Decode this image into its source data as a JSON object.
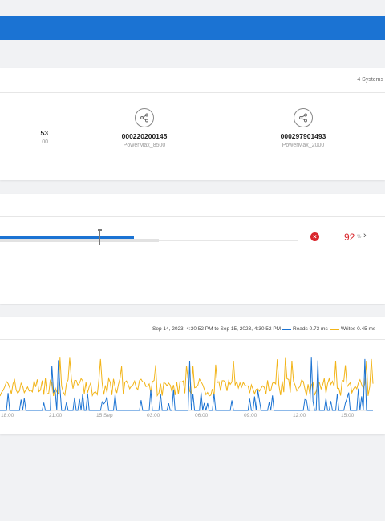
{
  "systems": {
    "count_label": "4 Systems",
    "items": [
      {
        "id": "53",
        "model": "00"
      },
      {
        "id": "000220200145",
        "model": "PowerMax_8500"
      },
      {
        "id": "000297901493",
        "model": "PowerMax_2000"
      }
    ]
  },
  "capacity": {
    "percent": "92",
    "unit": "%",
    "bar_fill_fraction": 0.84,
    "status_color": "#d9262c"
  },
  "latency": {
    "range": "Sep 14, 2023, 4:30:52 PM to Sep 15, 2023, 4:30:52 PM",
    "legend": {
      "reads": "Reads 0.73 ms",
      "writes": "Writes 0.45 ms"
    },
    "x_ticks": [
      "18:00",
      "21:00",
      "15 Sep",
      "03:00",
      "06:00",
      "09:00",
      "12:00",
      "15:00"
    ],
    "colors": {
      "reads": "#1b73d3",
      "writes": "#f2b418"
    }
  }
}
